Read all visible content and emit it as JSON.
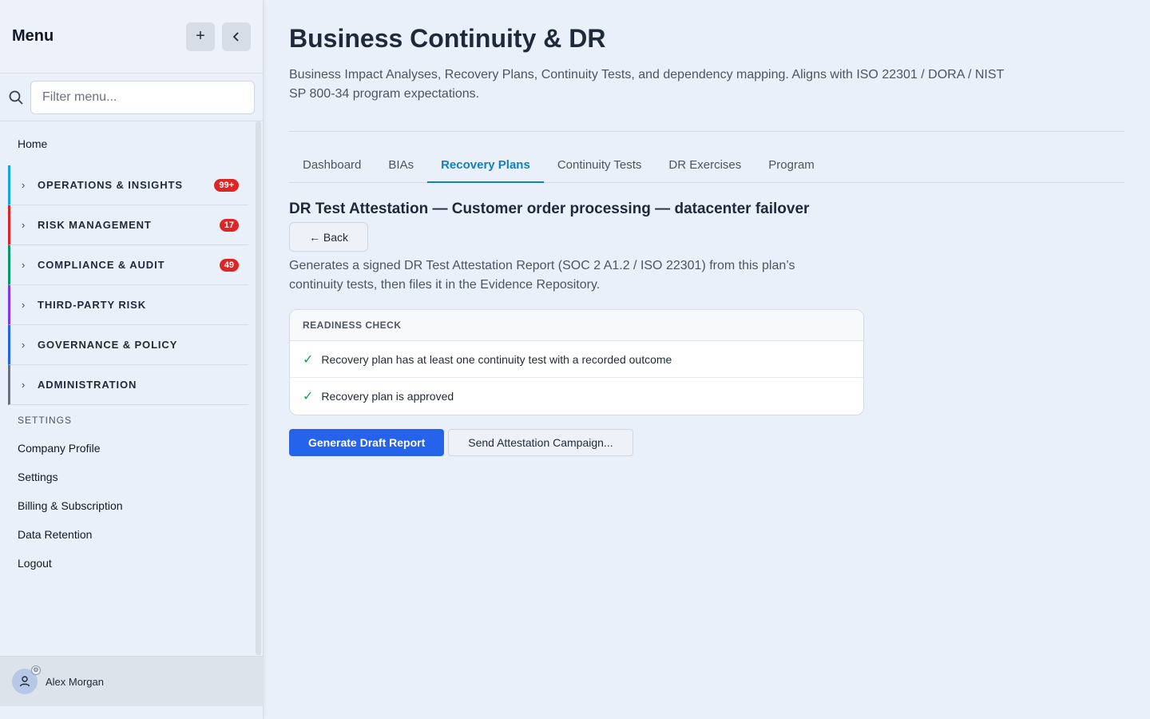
{
  "sidebar": {
    "title": "Menu",
    "add_icon": "plus-icon",
    "collapse_icon": "chevron-left-icon",
    "filter_placeholder": "Filter menu...",
    "home": "Home",
    "sections": [
      {
        "label": "OPERATIONS & INSIGHTS",
        "badge": "99+",
        "color": "#0ea5e9"
      },
      {
        "label": "RISK MANAGEMENT",
        "badge": "17",
        "color": "#dc2626"
      },
      {
        "label": "COMPLIANCE & AUDIT",
        "badge": "49",
        "color": "#059669"
      },
      {
        "label": "THIRD-PARTY RISK",
        "badge": "",
        "color": "#7c3aed"
      },
      {
        "label": "GOVERNANCE & POLICY",
        "badge": "",
        "color": "#2563eb"
      },
      {
        "label": "ADMINISTRATION",
        "badge": "",
        "color": "#6b7280"
      }
    ],
    "settings_label": "SETTINGS",
    "settings_items": [
      "Company Profile",
      "Settings",
      "Billing & Subscription",
      "Data Retention",
      "Logout"
    ],
    "user_name": "Alex Morgan"
  },
  "main": {
    "title": "Business Continuity & DR",
    "description": "Business Impact Analyses, Recovery Plans, Continuity Tests, and dependency mapping. Aligns with ISO 22301 / DORA / NIST SP 800-34 program expectations.",
    "tabs": [
      {
        "label": "Dashboard",
        "active": false
      },
      {
        "label": "BIAs",
        "active": false
      },
      {
        "label": "Recovery Plans",
        "active": true
      },
      {
        "label": "Continuity Tests",
        "active": false
      },
      {
        "label": "DR Exercises",
        "active": false
      },
      {
        "label": "Program",
        "active": false
      }
    ],
    "detail_title": "DR Test Attestation — Customer order processing — datacenter failover",
    "back_label": "← Back",
    "generate_description": "Generates a signed DR Test Attestation Report (SOC 2 A1.2 / ISO 22301) from this plan’s continuity tests, then files it in the Evidence Repository.",
    "readiness": {
      "header": "READINESS CHECK",
      "items": [
        "Recovery plan has at least one continuity test with a recorded outcome",
        "Recovery plan is approved"
      ]
    },
    "primary_action": "Generate Draft Report",
    "secondary_action": "Send Attestation Campaign..."
  }
}
